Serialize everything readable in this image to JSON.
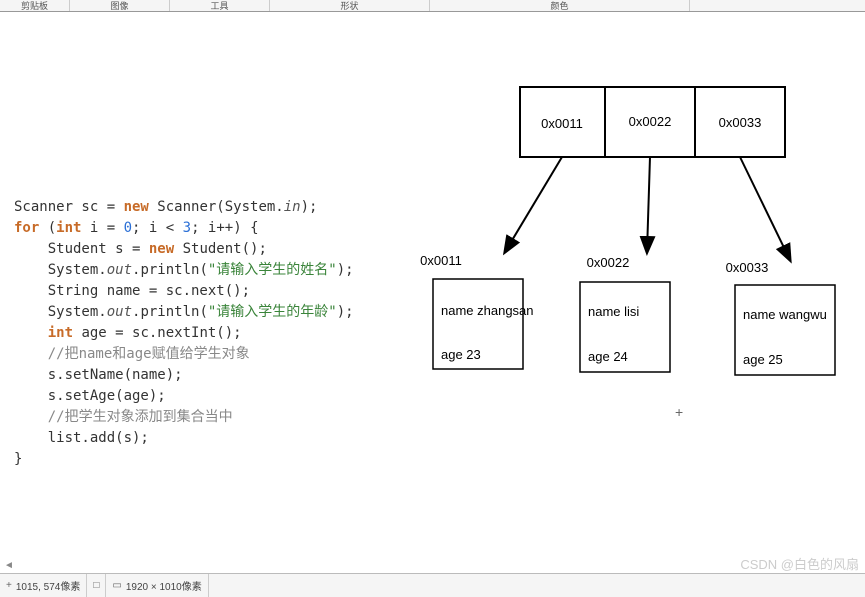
{
  "toolbar": {
    "tab1": "剪贴板",
    "tab2": "图像",
    "tab3": "工具",
    "tab4": "形状",
    "tab5": "颜色"
  },
  "code": {
    "l1a": "Scanner sc = ",
    "l1b": "new",
    "l1c": " Scanner(System.",
    "l1d": "in",
    "l1e": ");",
    "l2a": "for",
    "l2b": " (",
    "l2c": "int",
    "l2d": " i = ",
    "l2e": "0",
    "l2f": "; i < ",
    "l2g": "3",
    "l2h": "; i++) {",
    "l3a": "    Student s = ",
    "l3b": "new",
    "l3c": " Student();",
    "l4a": "    System.",
    "l4b": "out",
    "l4c": ".println(",
    "l4d": "\"请输入学生的姓名\"",
    "l4e": ");",
    "l5a": "    String name = sc.next();",
    "l6a": "    System.",
    "l6b": "out",
    "l6c": ".println(",
    "l6d": "\"请输入学生的年龄\"",
    "l6e": ");",
    "l7a": "    ",
    "l7b": "int",
    "l7c": " age = sc.nextInt();",
    "l8": "",
    "l9": "    //把name和age赋值给学生对象",
    "l10": "    s.setName(name);",
    "l11": "    s.setAge(age);",
    "l12": "",
    "l13": "    //把学生对象添加到集合当中",
    "l14": "    list.add(s);",
    "l15": "}"
  },
  "diagram": {
    "arr": [
      "0x0011",
      "0x0022",
      "0x0033"
    ],
    "ptr": [
      "0x0011",
      "0x0022",
      "0x0033"
    ],
    "s1": {
      "name": "name zhangsan",
      "age": "age 23"
    },
    "s2": {
      "name_lbl": "name ",
      "name_val": "lisi",
      "age_lbl": "age   ",
      "age_val": "24"
    },
    "s3": {
      "name": "name wangwu",
      "age": "age 25"
    }
  },
  "statusbar": {
    "coords": "1015, 574像素",
    "dims": "1920 × 1010像素"
  },
  "watermark": "CSDN @白色的风扇"
}
